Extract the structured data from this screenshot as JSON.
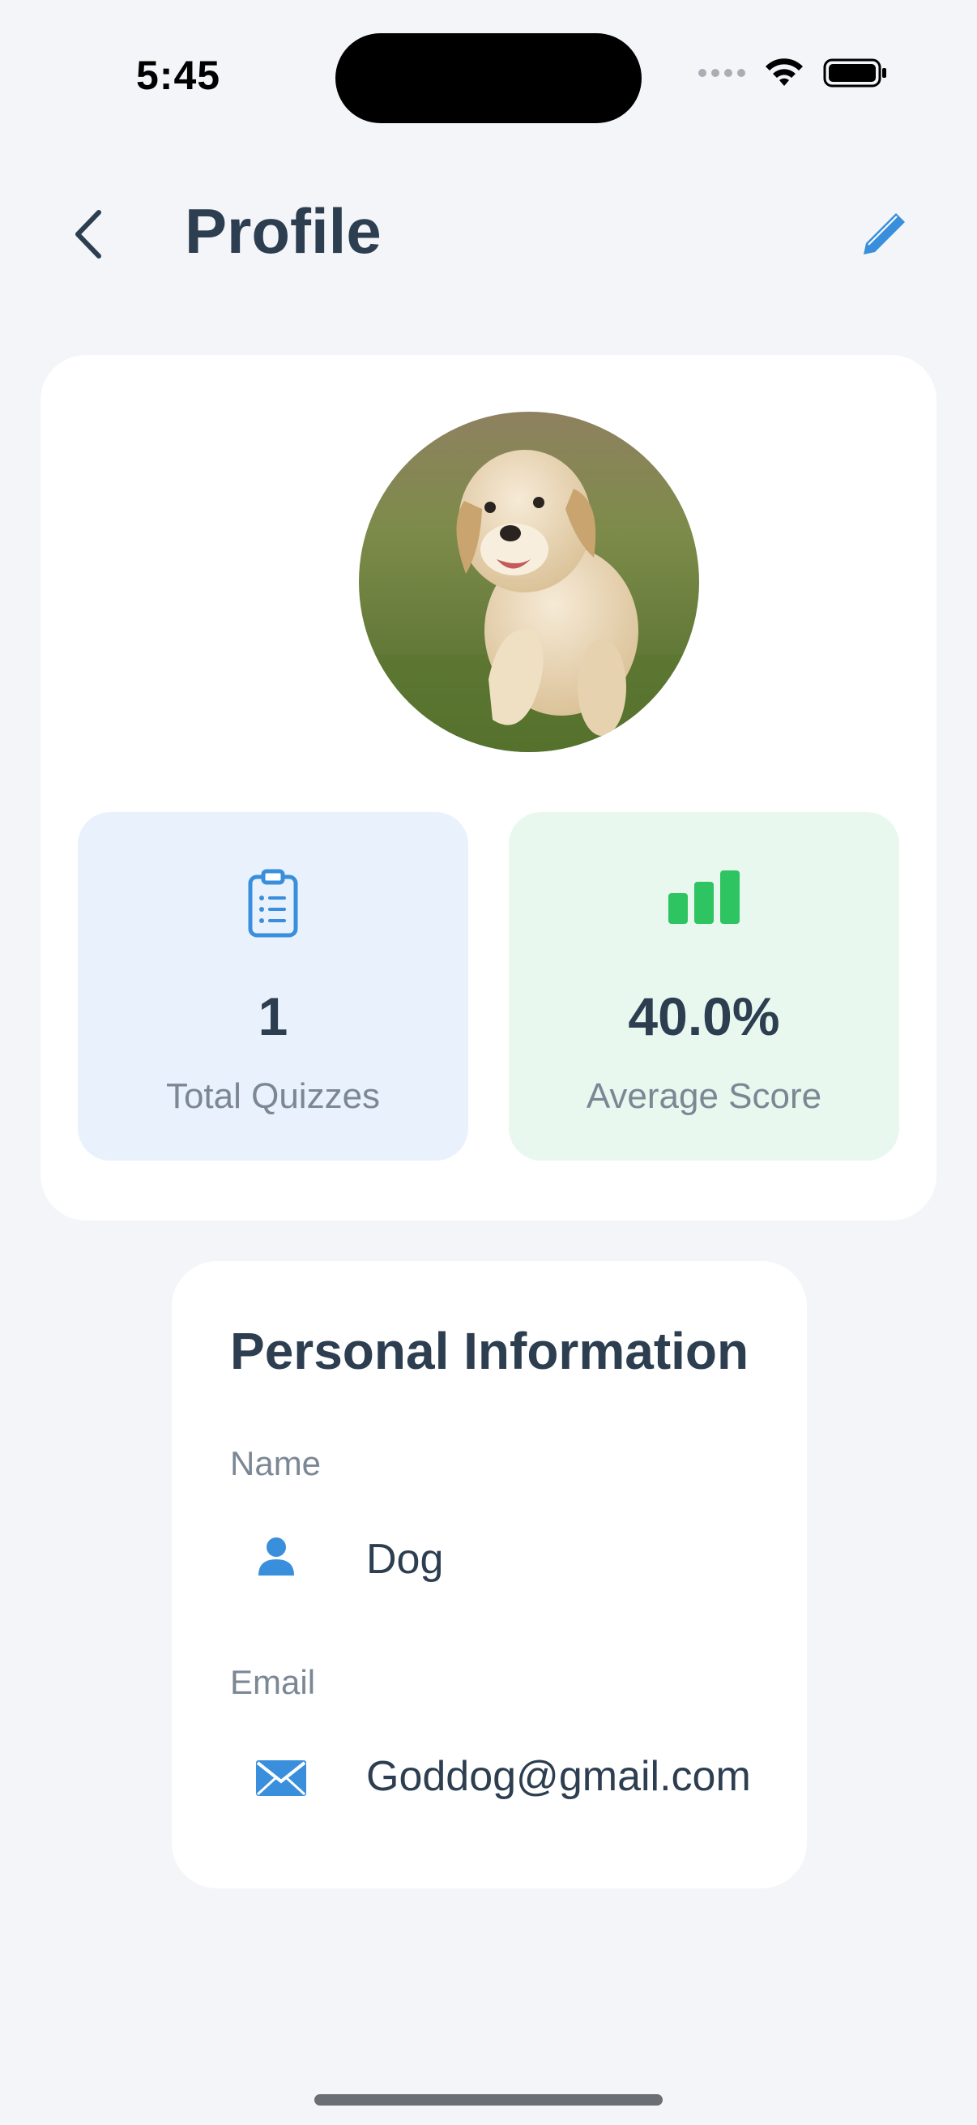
{
  "status_bar": {
    "time": "5:45"
  },
  "header": {
    "title": "Profile",
    "back_icon": "chevron-left-icon",
    "edit_icon": "pencil-icon"
  },
  "stats": [
    {
      "value": "1",
      "label": "Total Quizzes",
      "icon": "clipboard-list-icon",
      "color": "#3a8fdc"
    },
    {
      "value": "40.0%",
      "label": "Average Score",
      "icon": "bar-chart-icon",
      "color": "#2fc462"
    }
  ],
  "personal_info": {
    "title": "Personal Information",
    "name_label": "Name",
    "name_value": "Dog",
    "email_label": "Email",
    "email_value": "Goddog@gmail.com"
  },
  "colors": {
    "accent": "#3a8fdc",
    "success": "#2fc462",
    "text": "#2c3e50",
    "muted": "#7b8794",
    "background": "#f3f5f9"
  }
}
